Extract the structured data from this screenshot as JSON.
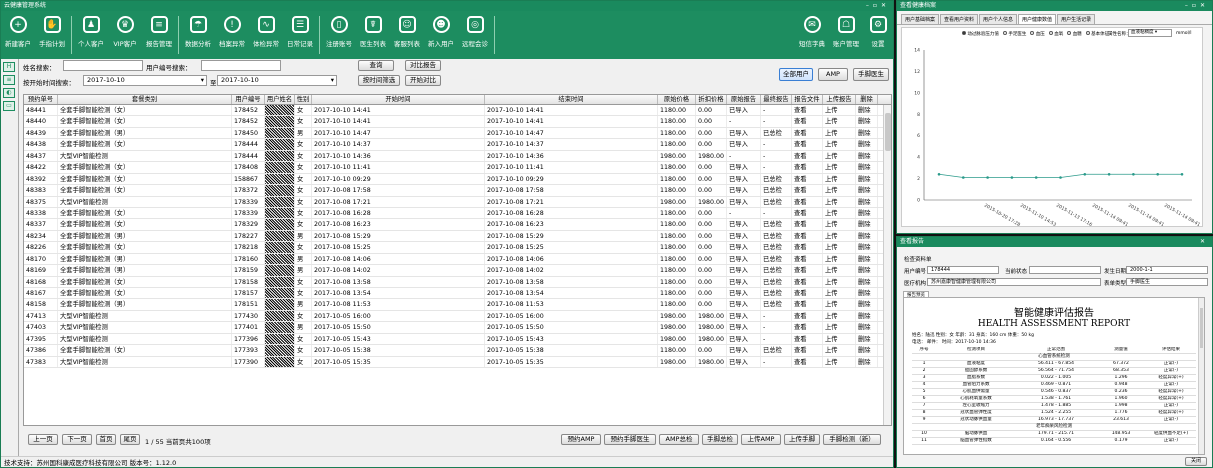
{
  "main_window": {
    "title": "云健康管理系统",
    "toolbar": [
      {
        "label": "新建客户",
        "icon": "user-add-icon",
        "glyph": "+"
      },
      {
        "label": "手指计划",
        "icon": "hand-plan-icon",
        "glyph": "✋"
      },
      {
        "label": "个人客户",
        "icon": "person-group-icon",
        "glyph": "♟"
      },
      {
        "label": "VIP客户",
        "icon": "vip-user-icon",
        "glyph": "♛"
      },
      {
        "label": "报告管理",
        "icon": "report-icon",
        "glyph": "≡"
      },
      {
        "label": "数据分析",
        "icon": "analysis-icon",
        "glyph": "☂"
      },
      {
        "label": "档案异常",
        "icon": "archive-alert-icon",
        "glyph": "!"
      },
      {
        "label": "体检异常",
        "icon": "exam-alert-icon",
        "glyph": "∿"
      },
      {
        "label": "日常记录",
        "icon": "notebook-icon",
        "glyph": "☰"
      },
      {
        "label": "注册账号",
        "icon": "phone-register-icon",
        "glyph": "▯"
      },
      {
        "label": "医生列表",
        "icon": "doctor-icon",
        "glyph": "☤"
      },
      {
        "label": "客服列表",
        "icon": "service-icon",
        "glyph": "☺"
      },
      {
        "label": "新入用户",
        "icon": "new-user-icon",
        "glyph": "☻"
      },
      {
        "label": "远程会诊",
        "icon": "remote-consult-icon",
        "glyph": "◎"
      }
    ],
    "toolbar_right": [
      {
        "label": "短信字典",
        "icon": "sms-dict-icon",
        "glyph": "✉"
      },
      {
        "label": "账户管理",
        "icon": "account-icon",
        "glyph": "☖"
      },
      {
        "label": "设置",
        "icon": "gear-icon",
        "glyph": "⚙"
      }
    ],
    "form": {
      "name_label": "姓名搜索：",
      "userid_label": "用户编号搜索：",
      "time_label": "按开始时间搜索：",
      "date_from": "2017-10-10",
      "to_label": "至",
      "date_to": "2017-10-10",
      "query": "查询",
      "compare_report": "对比报告",
      "time_filter": "按时间筛选",
      "compare_start": "开始对比",
      "all_users": "全部用户",
      "amp": "AMP",
      "hand_doctor": "手脚医生"
    },
    "columns": [
      "预约单号",
      "套餐类别",
      "用户编号",
      "用户姓名",
      "性别",
      "开始时间",
      "结束时间",
      "原始价格",
      "折扣价格",
      "原始报告",
      "最终报告",
      "报告文件",
      "上传报告",
      "删除"
    ],
    "rows": [
      [
        "48441",
        "全套手脚智能检测（女）",
        "178452",
        "",
        "女",
        "2017-10-10 14:41",
        "2017-10-10 14:41",
        "1180.00",
        "0.00",
        "已导入",
        "-",
        "查看",
        "上传",
        "删除"
      ],
      [
        "48440",
        "全套手脚智能检测（女）",
        "178452",
        "",
        "女",
        "2017-10-10 14:41",
        "2017-10-10 14:41",
        "1180.00",
        "0.00",
        "-",
        "-",
        "查看",
        "上传",
        "删除"
      ],
      [
        "48439",
        "全套手脚智能检测（男）",
        "178450",
        "",
        "男",
        "2017-10-10 14:47",
        "2017-10-10 14:47",
        "1180.00",
        "0.00",
        "已导入",
        "已总检",
        "查看",
        "上传",
        "删除"
      ],
      [
        "48438",
        "全套手脚智能检测（女）",
        "178444",
        "",
        "女",
        "2017-10-10 14:37",
        "2017-10-10 14:37",
        "1180.00",
        "0.00",
        "已导入",
        "-",
        "查看",
        "上传",
        "删除"
      ],
      [
        "48437",
        "大型VIP智能检测",
        "178444",
        "",
        "女",
        "2017-10-10 14:36",
        "2017-10-10 14:36",
        "1980.00",
        "1980.00",
        "-",
        "-",
        "查看",
        "上传",
        "删除"
      ],
      [
        "48422",
        "全套手脚智能检测（女）",
        "178408",
        "",
        "女",
        "2017-10-10 11:41",
        "2017-10-10 11:41",
        "1180.00",
        "0.00",
        "已导入",
        "-",
        "查看",
        "上传",
        "删除"
      ],
      [
        "48392",
        "全套手脚智能检测（女）",
        "158867",
        "",
        "女",
        "2017-10-10 09:29",
        "2017-10-10 09:29",
        "1180.00",
        "0.00",
        "已导入",
        "已总检",
        "查看",
        "上传",
        "删除"
      ],
      [
        "48383",
        "全套手脚智能检测（女）",
        "178372",
        "",
        "女",
        "2017-10-08 17:58",
        "2017-10-08 17:58",
        "1180.00",
        "0.00",
        "已导入",
        "已总检",
        "查看",
        "上传",
        "删除"
      ],
      [
        "48375",
        "大型VIP智能检测",
        "178339",
        "",
        "女",
        "2017-10-08 17:21",
        "2017-10-08 17:21",
        "1980.00",
        "1980.00",
        "已导入",
        "已总检",
        "查看",
        "上传",
        "删除"
      ],
      [
        "48338",
        "全套手脚智能检测（女）",
        "178339",
        "",
        "女",
        "2017-10-08 16:28",
        "2017-10-08 16:28",
        "1180.00",
        "0.00",
        "-",
        "-",
        "查看",
        "上传",
        "删除"
      ],
      [
        "48337",
        "全套手脚智能检测（女）",
        "178329",
        "",
        "女",
        "2017-10-08 16:23",
        "2017-10-08 16:23",
        "1180.00",
        "0.00",
        "已导入",
        "已总检",
        "查看",
        "上传",
        "删除"
      ],
      [
        "48234",
        "全套手脚智能检测（男）",
        "178227",
        "",
        "男",
        "2017-10-08 15:29",
        "2017-10-08 15:29",
        "1180.00",
        "0.00",
        "已导入",
        "已总检",
        "查看",
        "上传",
        "删除"
      ],
      [
        "48226",
        "全套手脚智能检测（女）",
        "178218",
        "",
        "女",
        "2017-10-08 15:25",
        "2017-10-08 15:25",
        "1180.00",
        "0.00",
        "已导入",
        "已总检",
        "查看",
        "上传",
        "删除"
      ],
      [
        "48170",
        "全套手脚智能检测（男）",
        "178160",
        "",
        "男",
        "2017-10-08 14:06",
        "2017-10-08 14:06",
        "1180.00",
        "0.00",
        "已导入",
        "已总检",
        "查看",
        "上传",
        "删除"
      ],
      [
        "48169",
        "全套手脚智能检测（男）",
        "178159",
        "",
        "男",
        "2017-10-08 14:02",
        "2017-10-08 14:02",
        "1180.00",
        "0.00",
        "已导入",
        "已总检",
        "查看",
        "上传",
        "删除"
      ],
      [
        "48168",
        "全套手脚智能检测（女）",
        "178158",
        "",
        "女",
        "2017-10-08 13:58",
        "2017-10-08 13:58",
        "1180.00",
        "0.00",
        "已导入",
        "已总检",
        "查看",
        "上传",
        "删除"
      ],
      [
        "48167",
        "全套手脚智能检测（女）",
        "178157",
        "",
        "女",
        "2017-10-08 13:54",
        "2017-10-08 13:54",
        "1180.00",
        "0.00",
        "已导入",
        "已总检",
        "查看",
        "上传",
        "删除"
      ],
      [
        "48158",
        "全套手脚智能检测（男）",
        "178151",
        "",
        "男",
        "2017-10-08 11:53",
        "2017-10-08 11:53",
        "1180.00",
        "0.00",
        "已导入",
        "已总检",
        "查看",
        "上传",
        "删除"
      ],
      [
        "47413",
        "大型VIP智能检测",
        "177430",
        "",
        "女",
        "2017-10-05 16:00",
        "2017-10-05 16:00",
        "1980.00",
        "1980.00",
        "已导入",
        "-",
        "查看",
        "上传",
        "删除"
      ],
      [
        "47403",
        "大型VIP智能检测",
        "177401",
        "",
        "男",
        "2017-10-05 15:50",
        "2017-10-05 15:50",
        "1980.00",
        "1980.00",
        "已导入",
        "-",
        "查看",
        "上传",
        "删除"
      ],
      [
        "47395",
        "大型VIP智能检测",
        "177396",
        "",
        "女",
        "2017-10-05 15:43",
        "2017-10-05 15:43",
        "1980.00",
        "1980.00",
        "已导入",
        "-",
        "查看",
        "上传",
        "删除"
      ],
      [
        "47386",
        "全套手脚智能检测（女）",
        "177393",
        "",
        "女",
        "2017-10-05 15:38",
        "2017-10-05 15:38",
        "1180.00",
        "0.00",
        "已导入",
        "已总检",
        "查看",
        "上传",
        "删除"
      ],
      [
        "47383",
        "大型VIP智能检测",
        "177390",
        "",
        "女",
        "2017-10-05 15:35",
        "2017-10-05 15:35",
        "1980.00",
        "1980.00",
        "已导入",
        "-",
        "查看",
        "上传",
        "删除"
      ]
    ],
    "pager": {
      "prev": "上一页",
      "next": "下一页",
      "first": "首页",
      "last": "尾页",
      "info": "1 / 55 当前页共100项"
    },
    "bottom_buttons": [
      "预约AMP",
      "预约手脚医生",
      "AMP总检",
      "手脚总检",
      "上传AMP",
      "上传手脚",
      "手脚检测（新）"
    ],
    "status": "技术支持：苏州国科康成医疗科技有限公司 版本号：1.12.0"
  },
  "chart_window": {
    "title": "查看健康档案",
    "tabs": [
      "用户基础档案",
      "查看用户资料",
      "用户个人信息",
      "用户健康数值",
      "用户生活记录"
    ],
    "radio_options": [
      "动过脉验压力值",
      "手足医生",
      "血压",
      "血氧",
      "血糖",
      "基本体征"
    ],
    "select_label": "属性名称：",
    "select_value": "血液粘稠度",
    "unit": "mmol/l",
    "chart_data": {
      "type": "line",
      "x": [
        "2015-10-20 17:28",
        "2015-11-10 14:53",
        "2015-11-13 17:16",
        "2015-11-14 09:41",
        "2015-11-14 09:41",
        "2015-11-14 09:41"
      ],
      "values": [
        2.4,
        2.1,
        2.1,
        2.1,
        2.1,
        2.1,
        2.4,
        2.4,
        2.4,
        2.4,
        2.4
      ],
      "ylim": [
        0,
        14
      ],
      "yticks": [
        "0",
        "2",
        "4",
        "6",
        "8",
        "10",
        "12",
        "14"
      ]
    }
  },
  "report_window": {
    "title": "查看报告",
    "header": {
      "section": "检查资料单",
      "uid_label": "用户编号",
      "uid": "178444",
      "status_label": "当前状态",
      "date_label": "发生日期",
      "date": "2000-1-1",
      "org_label": "医疗机构",
      "org": "苏州嘉康智健康管理有限公司",
      "type_label": "表单类型",
      "type": "手脚医生"
    },
    "tab": "报告预览",
    "report": {
      "title_cn": "智能健康评估报告",
      "title_en": "HEALTH ASSESSMENT REPORT",
      "info1": "姓名：陆迅    性别：女    年龄：31    身高：160 cm    体重：50 kg",
      "info2": "电话：         邮件：         时间：2017-10-10 14:36",
      "cols": [
        "序号",
        "检测项目",
        "正常范围",
        "测量值",
        "评估结果"
      ],
      "section1": "心血管系统检测",
      "rows": [
        [
          "1",
          "血液粘度",
          "56.411 - 67.854",
          "67.372",
          "正常(-)"
        ],
        [
          "2",
          "胆固醇系数",
          "56.564 - 71.754",
          "68.353",
          "正常(-)"
        ],
        [
          "3",
          "血脂系数",
          "0.022 - 1.005",
          "1.296",
          "轻度异常(+)"
        ],
        [
          "4",
          "血管阻力系数",
          "0.469 - 0.871",
          "0.948",
          "正常(-)"
        ],
        [
          "5",
          "心肌血供需量",
          "0.546 - 0.837",
          "0.236",
          "轻度异常(+)"
        ],
        [
          "6",
          "心肌耗氧量系数",
          "1.538 - 1.761",
          "1.960",
          "轻度异常(+)"
        ],
        [
          "7",
          "左心室收缩力",
          "1.478 - 1.885",
          "1.998",
          "正常(-)"
        ],
        [
          "8",
          "冠状血管弹性度",
          "1.524 - 2.255",
          "1.776",
          "轻度异常(+)"
        ],
        [
          "9",
          "冠状动脉供血量",
          "16.973 - 17.737",
          "23.613",
          "正常(-)"
        ]
      ],
      "section2": "老年痴呆风险检测",
      "rows2": [
        [
          "10",
          "脑动脉供血",
          "179.71 - 215.71",
          "148.953",
          "轻度供血不足(+)"
        ],
        [
          "11",
          "脑血管弹性指数",
          "0.164 - 0.556",
          "0.179",
          "正常(-)"
        ]
      ]
    },
    "close": "关闭"
  }
}
